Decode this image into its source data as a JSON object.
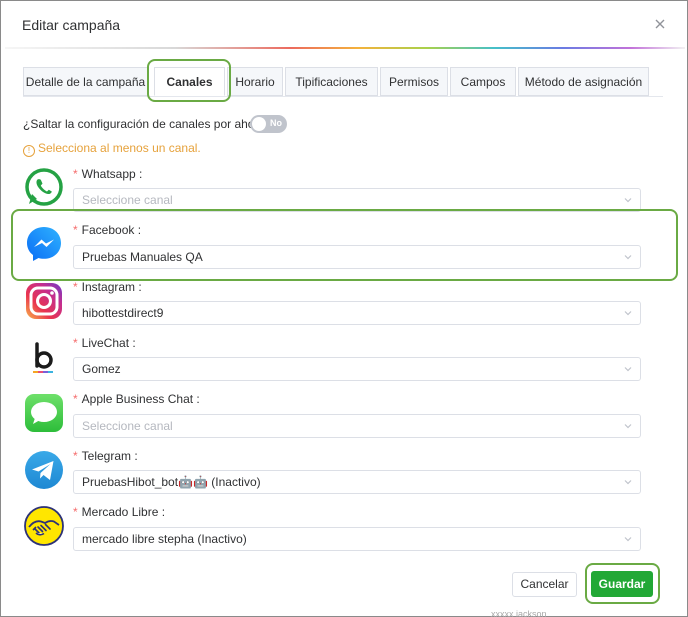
{
  "dialog": {
    "title": "Editar campaña"
  },
  "tabs": [
    {
      "label": "Detalle de la campaña",
      "active": false
    },
    {
      "label": "Canales",
      "active": true
    },
    {
      "label": "Horario",
      "active": false
    },
    {
      "label": "Tipificaciones",
      "active": false
    },
    {
      "label": "Permisos",
      "active": false
    },
    {
      "label": "Campos",
      "active": false
    },
    {
      "label": "Método de asignación",
      "active": false
    }
  ],
  "skip": {
    "question": "¿Saltar la configuración de canales por ahora?",
    "toggle_label": "No"
  },
  "warning": {
    "text": "Selecciona al menos un canal."
  },
  "channels": [
    {
      "label": "Whatsapp",
      "value": "Seleccione canal",
      "placeholder": true,
      "icon": "whatsapp-icon"
    },
    {
      "label": "Facebook",
      "value": "Pruebas Manuales QA",
      "placeholder": false,
      "icon": "messenger-icon"
    },
    {
      "label": "Instagram",
      "value": "hibottestdirect9",
      "placeholder": false,
      "icon": "instagram-icon"
    },
    {
      "label": "LiveChat",
      "value": "Gomez",
      "placeholder": false,
      "icon": "livechat-icon"
    },
    {
      "label": "Apple Business Chat",
      "value": "Seleccione canal",
      "placeholder": true,
      "icon": "apple-messages-icon"
    },
    {
      "label": "Telegram",
      "value": "PruebasHibot_bot🤖🤖 (Inactivo)",
      "placeholder": false,
      "icon": "telegram-icon"
    },
    {
      "label": "Mercado Libre",
      "value": "mercado libre stepha (Inactivo)",
      "placeholder": false,
      "icon": "mercado-libre-icon"
    }
  ],
  "footer": {
    "cancel_label": "Cancelar",
    "save_label": "Guardar"
  },
  "below": {
    "partial_text": "xxxxx jackson"
  },
  "colors": {
    "accent_green": "#22a836",
    "highlight_green": "#6aaa44",
    "warning_orange": "#e6a23c",
    "required_red": "#f56c6c"
  }
}
